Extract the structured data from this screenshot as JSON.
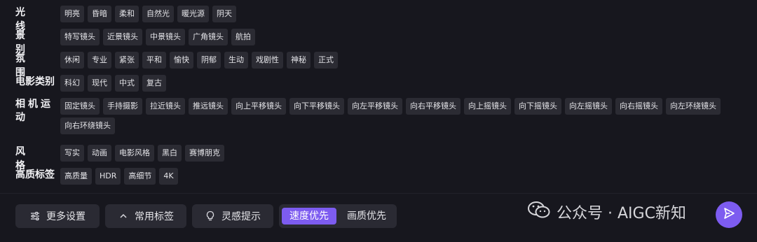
{
  "rows": [
    {
      "label": "光 线",
      "chips": [
        "明亮",
        "昏暗",
        "柔和",
        "自然光",
        "暖光源",
        "阴天"
      ]
    },
    {
      "label": "景 别",
      "chips": [
        "特写镜头",
        "近景镜头",
        "中景镜头",
        "广角镜头",
        "航拍"
      ]
    },
    {
      "label": "氛 围",
      "chips": [
        "休闲",
        "专业",
        "紧张",
        "平和",
        "愉快",
        "阴郁",
        "生动",
        "戏剧性",
        "神秘",
        "正式"
      ]
    },
    {
      "label": "电影类别",
      "chips": [
        "科幻",
        "现代",
        "中式",
        "复古"
      ]
    },
    {
      "label": "相机运动",
      "chips": [
        "固定镜头",
        "手持摄影",
        "拉近镜头",
        "推远镜头",
        "向上平移镜头",
        "向下平移镜头",
        "向左平移镜头",
        "向右平移镜头",
        "向上摇镜头",
        "向下摇镜头",
        "向左摇镜头",
        "向右摇镜头",
        "向左环绕镜头",
        "向右环绕镜头"
      ]
    },
    {
      "label": "风 格",
      "chips": [
        "写实",
        "动画",
        "电影风格",
        "黑白",
        "赛博朋克"
      ]
    },
    {
      "label": "高质标签",
      "chips": [
        "高质量",
        "HDR",
        "高细节",
        "4K"
      ]
    }
  ],
  "bottom": {
    "more_settings": "更多设置",
    "common_tags": "常用标签",
    "inspiration": "灵感提示",
    "speed_first": "速度优先",
    "quality_first": "画质优先"
  },
  "watermark": "公众号 · AIGC新知",
  "icons": {
    "more_settings": "sliders-icon",
    "common_tags": "chevron-up-icon",
    "inspiration": "lightbulb-icon",
    "watermark": "wechat-icon",
    "send": "send-icon"
  },
  "colors": {
    "accent": "#7d5cf0",
    "chip_bg": "#2b2b33",
    "bg": "#17171e"
  }
}
